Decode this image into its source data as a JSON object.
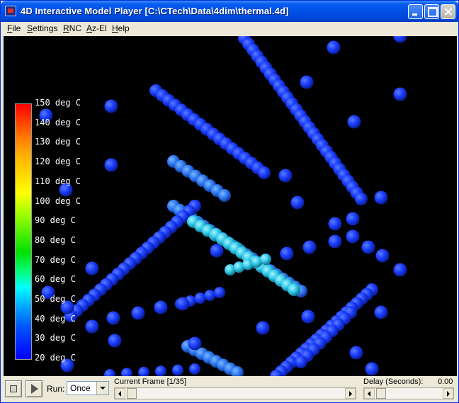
{
  "window": {
    "title": "4D Interactive Model Player  [C:\\CTech\\Data\\4dim\\thermal.4d]"
  },
  "menu": [
    {
      "underline": "F",
      "rest": "ile"
    },
    {
      "underline": "S",
      "rest": "ettings"
    },
    {
      "underline": "R",
      "rest": "NC"
    },
    {
      "underline": "A",
      "rest": "z-El"
    },
    {
      "underline": "H",
      "rest": "elp"
    }
  ],
  "legend": {
    "labels": [
      "150 deg C",
      "140 deg C",
      "130 deg C",
      "120 deg C",
      "110 deg C",
      "100 deg C",
      "90 deg C",
      "80 deg C",
      "70 deg C",
      "60 deg C",
      "50 deg C",
      "40 deg C",
      "30 deg C",
      "20 deg C"
    ],
    "colors": {
      "top": "#FF0000",
      "bottom": "#0000FF"
    }
  },
  "controls": {
    "run_label": "Run:",
    "run_value": "Once",
    "frame_label": "Current Frame [1/35]",
    "delay_label": "Delay (Seconds):",
    "delay_value": "0.00"
  },
  "colors": {
    "viewport_bg": "#000000",
    "sphere_cold": "#1A3CFF",
    "sphere_warm": "#30C8E8"
  }
}
